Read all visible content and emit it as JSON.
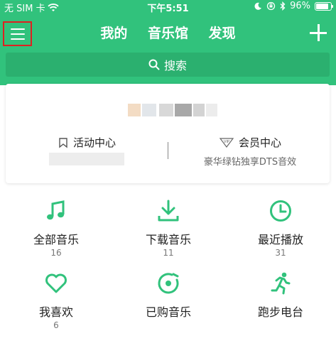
{
  "status_bar": {
    "carrier": "无 SIM 卡",
    "time": "下午5:51",
    "battery": "96%",
    "battery_level": 0.96
  },
  "nav": {
    "tabs": [
      "我的",
      "音乐馆",
      "发现"
    ]
  },
  "search": {
    "placeholder": "搜索"
  },
  "card": {
    "activity": {
      "label": "活动中心"
    },
    "member": {
      "label": "会员中心",
      "subtitle": "豪华绿钻独享DTS音效",
      "badge": "VIP"
    }
  },
  "grid": [
    {
      "label": "全部音乐",
      "count": "16",
      "icon": "music-note-icon"
    },
    {
      "label": "下载音乐",
      "count": "11",
      "icon": "download-icon"
    },
    {
      "label": "最近播放",
      "count": "31",
      "icon": "clock-icon"
    },
    {
      "label": "我喜欢",
      "count": "6",
      "icon": "heart-icon"
    },
    {
      "label": "已购音乐",
      "count": "",
      "icon": "purchased-disc-icon"
    },
    {
      "label": "跑步电台",
      "count": "",
      "icon": "running-icon"
    }
  ],
  "colors": {
    "brand": "#31c27c",
    "search_bg": "#2bb06f",
    "highlight": "#e02020"
  }
}
